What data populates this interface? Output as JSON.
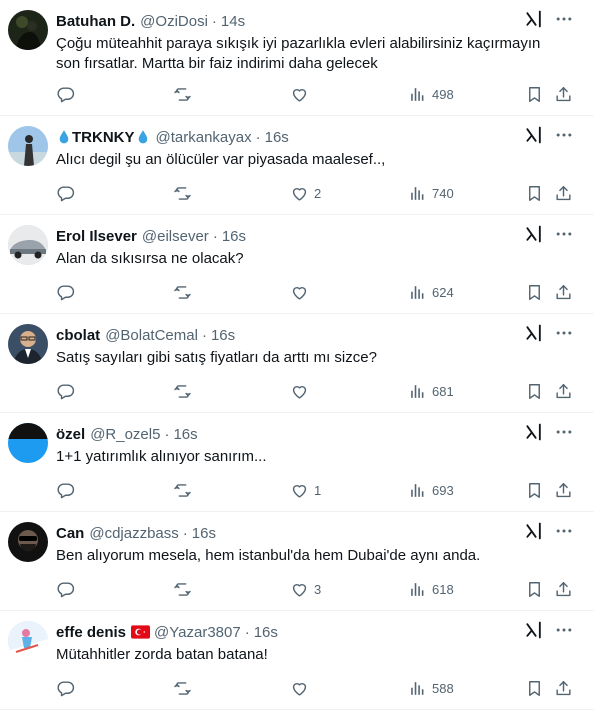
{
  "colors": {
    "text": "#0f1419",
    "muted": "#536471",
    "divider": "#eff3f4"
  },
  "tweets": [
    {
      "name": "Batuhan D.",
      "handle": "@OziDosi",
      "time": "14s",
      "text": "Çoğu müteahhit paraya sıkışık iyi pazarlıkla evleri alabilirsiniz kaçırmayın son fırsatlar. Martta bir faiz indirimi daha gelecek",
      "likes": "",
      "views": "498",
      "avatar": "dark-figure"
    },
    {
      "name": "TRKNKY",
      "handle": "@tarkankayax",
      "time": "16s",
      "text": "Alıcı degil şu an ölücüler var piyasada maalesef..,",
      "likes": "2",
      "views": "740",
      "avatar": "person-sky",
      "name_decoration": "water-drop-emoji"
    },
    {
      "name": "Erol Ilsever",
      "handle": "@eilsever",
      "time": "16s",
      "text": "Alan da sıkısırsa ne olacak?",
      "likes": "",
      "views": "624",
      "avatar": "car"
    },
    {
      "name": "cbolat",
      "handle": "@BolatCemal",
      "time": "16s",
      "text": "Satış sayıları gibi satış fiyatları da arttı mı sizce?",
      "likes": "",
      "views": "681",
      "avatar": "man-glasses"
    },
    {
      "name": "özel",
      "handle": "@R_ozel5",
      "time": "16s",
      "text": "1+1 yatırımlık alınıyor sanırım...",
      "likes": "1",
      "views": "693",
      "avatar": "blue-black"
    },
    {
      "name": "Can",
      "handle": "@cdjazzbass",
      "time": "16s",
      "text": "Ben alıyorum mesela, hem istanbul'da hem Dubai'de aynı anda.",
      "likes": "3",
      "views": "618",
      "avatar": "bearded-man"
    },
    {
      "name": "effe denis",
      "handle": "@Yazar3807",
      "time": "16s",
      "text": "Mütahhitler zorda batan batana!",
      "likes": "",
      "views": "588",
      "avatar": "skier",
      "name_decoration": "turkey-flag-emoji"
    }
  ]
}
